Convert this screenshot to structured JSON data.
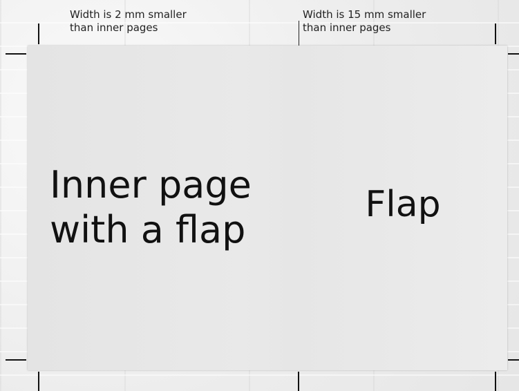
{
  "annotations": {
    "inner_width_note": "Width is 2 mm smaller\nthan inner pages",
    "flap_width_note": "Width is 15 mm smaller\nthan inner pages"
  },
  "panels": {
    "inner_page_label": "Inner page\nwith a flap",
    "flap_label": "Flap"
  },
  "colors": {
    "page": "#e8e8e8",
    "background": "#f1f1f1",
    "marks": "#111111"
  }
}
